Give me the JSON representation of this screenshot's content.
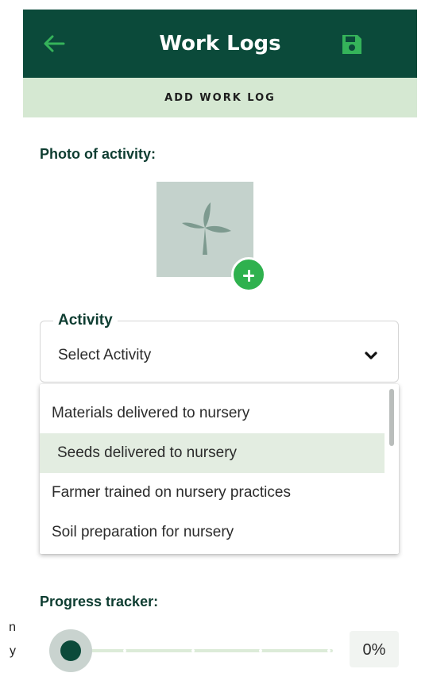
{
  "background_text": {
    "line1": "n",
    "line2": "y"
  },
  "app_bar": {
    "title": "Work Logs",
    "back_icon": "arrow-left-icon",
    "save_icon": "floppy-disk-icon",
    "bg_color": "#0b4a3a",
    "icon_color": "#35b35a"
  },
  "sub_header": {
    "label": "ADD WORK LOG",
    "bg_color": "#d5e8d2"
  },
  "photo_section": {
    "label": "Photo of activity:",
    "placeholder_icon": "sprout-icon",
    "add_icon": "plus-icon"
  },
  "activity_field": {
    "label": "Activity",
    "value": "Select Activity",
    "icon": "chevron-down-icon"
  },
  "activity_options": [
    {
      "label": "Materials delivered to nursery",
      "selected": false
    },
    {
      "label": "Seeds delivered to nursery",
      "selected": true
    },
    {
      "label": "Farmer trained on nursery practices",
      "selected": false
    },
    {
      "label": "Soil preparation for nursery",
      "selected": false
    }
  ],
  "progress": {
    "label": "Progress tracker:",
    "value_percent": 0,
    "display": "0%"
  }
}
